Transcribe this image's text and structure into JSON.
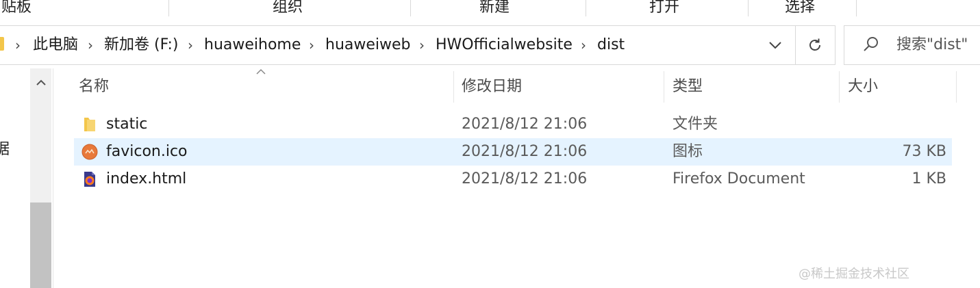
{
  "ribbon": {
    "groups": [
      "贴板",
      "组织",
      "新建",
      "打开",
      "选择"
    ]
  },
  "address_bar": {
    "breadcrumb": [
      "此电脑",
      "新加卷 (F:)",
      "huaweihome",
      "huaweiweb",
      "HWOfficialwebsite",
      "dist"
    ],
    "dropdown_icon": "chevron-down-icon",
    "refresh_icon": "refresh-icon"
  },
  "search": {
    "placeholder": "搜索\"dist\"",
    "icon": "search-icon"
  },
  "nav_pane": {
    "partial_label": "据"
  },
  "columns": {
    "name": "名称",
    "date": "修改日期",
    "type": "类型",
    "size": "大小"
  },
  "files": [
    {
      "name": "static",
      "date": "2021/8/12 21:06",
      "type": "文件夹",
      "size": "",
      "icon": "folder-icon",
      "selected": false
    },
    {
      "name": "favicon.ico",
      "date": "2021/8/12 21:06",
      "type": "图标",
      "size": "73 KB",
      "icon": "ico-file-icon",
      "selected": true
    },
    {
      "name": "index.html",
      "date": "2021/8/12 21:06",
      "type": "Firefox Document",
      "size": "1 KB",
      "icon": "firefox-html-icon",
      "selected": false
    }
  ],
  "watermark": "@稀土掘金技术社区",
  "colors": {
    "selection": "#e5f3ff",
    "folder": "#f3c64a",
    "scroll_thumb": "#c2c2c2"
  }
}
